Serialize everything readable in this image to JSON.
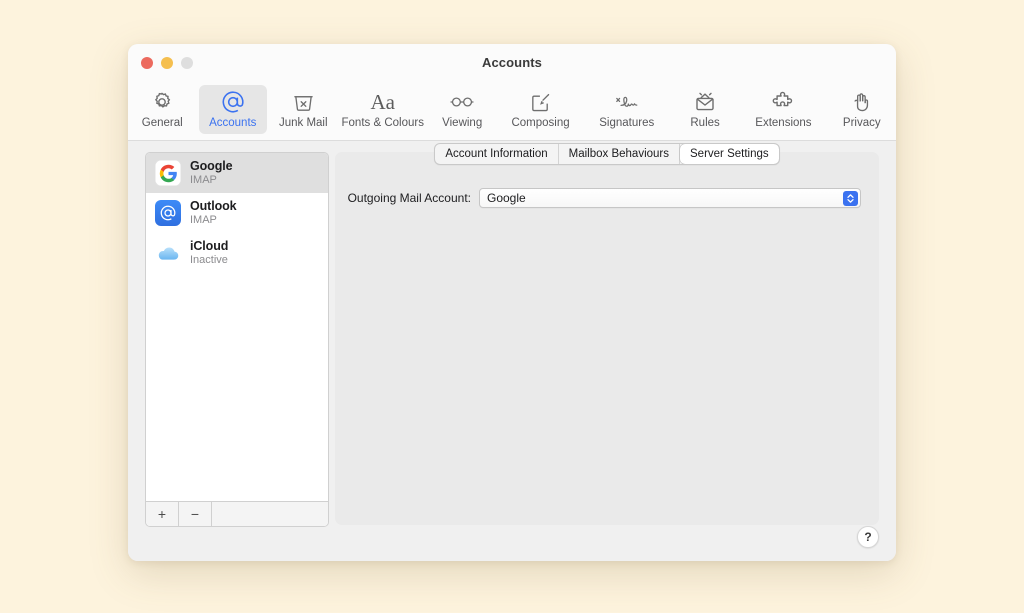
{
  "window": {
    "title": "Accounts",
    "traffic_lights": [
      {
        "name": "close",
        "color": "#ec6a5e"
      },
      {
        "name": "minimize",
        "color": "#f5bf4f"
      },
      {
        "name": "zoom",
        "color": "#dedede"
      }
    ]
  },
  "toolbar": {
    "items": [
      {
        "label": "General",
        "icon": "gear-icon",
        "selected": false
      },
      {
        "label": "Accounts",
        "icon": "at-sign-icon",
        "selected": true
      },
      {
        "label": "Junk Mail",
        "icon": "trash-x-icon",
        "selected": false
      },
      {
        "label": "Fonts & Colours",
        "icon": "aa-text-icon",
        "selected": false
      },
      {
        "label": "Viewing",
        "icon": "glasses-icon",
        "selected": false
      },
      {
        "label": "Composing",
        "icon": "compose-pencil-icon",
        "selected": false
      },
      {
        "label": "Signatures",
        "icon": "signature-icon",
        "selected": false
      },
      {
        "label": "Rules",
        "icon": "rules-envelope-icon",
        "selected": false
      },
      {
        "label": "Extensions",
        "icon": "puzzle-piece-icon",
        "selected": false
      },
      {
        "label": "Privacy",
        "icon": "hand-icon",
        "selected": false
      }
    ],
    "accent_color": "#3b72f0"
  },
  "sidebar": {
    "accounts": [
      {
        "name": "Google",
        "status": "IMAP",
        "icon": "google-logo-icon",
        "selected": true
      },
      {
        "name": "Outlook",
        "status": "IMAP",
        "icon": "outlook-at-icon",
        "selected": false
      },
      {
        "name": "iCloud",
        "status": "Inactive",
        "icon": "icloud-cloud-icon",
        "selected": false
      }
    ],
    "footer": {
      "add_label": "+",
      "remove_label": "−"
    }
  },
  "main": {
    "tabs": [
      {
        "label": "Account Information",
        "active": false
      },
      {
        "label": "Mailbox Behaviours",
        "active": false
      },
      {
        "label": "Server Settings",
        "active": true
      }
    ],
    "fields": [
      {
        "label": "Outgoing Mail Account:",
        "value": "Google",
        "control": "popup-button"
      }
    ]
  },
  "help": {
    "label": "?"
  }
}
